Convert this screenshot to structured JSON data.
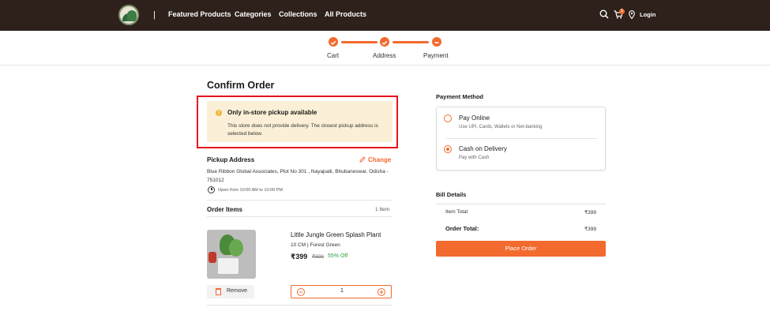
{
  "header": {
    "separator": "|",
    "nav": [
      "Featured Products",
      "Categories",
      "Collections",
      "All Products"
    ],
    "cart_count": "1",
    "login_label": "Login"
  },
  "stepper": {
    "steps": [
      "Cart",
      "Address",
      "Payment"
    ],
    "completed": 2,
    "current": 3
  },
  "page": {
    "title": "Confirm Order"
  },
  "alert": {
    "icon_glyph": "i",
    "title": "Only in-store pickup available",
    "body": "This store does not provide delivery. The closest pickup address is selected below."
  },
  "pickup": {
    "title": "Pickup Address",
    "change_label": "Change",
    "address": "Blue Ribbon Global Associates, Plot No 301 , Nayapalli, Bhubaneswar, Odisha - 751012",
    "hours": "Open from 10:00 AM to 10:00 PM"
  },
  "order_items": {
    "title": "Order Items",
    "count_label": "1 Item",
    "items": [
      {
        "name": "Little Jungle Green Splash Plant",
        "variant": "10 CM | Forest Green",
        "price": "₹399",
        "mrp": "₹899",
        "discount": "55% Off",
        "quantity": "1",
        "remove_label": "Remove",
        "minus_glyph": "−",
        "plus_glyph": "+"
      }
    ]
  },
  "payment": {
    "title": "Payment Method",
    "options": [
      {
        "name": "Pay Online",
        "sub": "Use UPI, Cards, Wallets or Net-banking",
        "selected": false
      },
      {
        "name": "Cash on Delivery",
        "sub": "Pay with Cash",
        "selected": true
      }
    ]
  },
  "bill": {
    "title": "Bill Details",
    "item_total_label": "Item Total",
    "item_total_value": "₹399",
    "order_total_label": "Order Total:",
    "order_total_value": "₹399",
    "place_order_label": "Place Order"
  },
  "icons": {
    "logo": "store-logo",
    "search": "search-icon",
    "cart": "cart-icon",
    "location": "location-pin-icon",
    "info": "info-icon",
    "edit": "pencil-icon",
    "clock": "clock-icon",
    "trash": "trash-icon"
  },
  "colors": {
    "header_bg": "#2e211b",
    "accent": "#f26a2e",
    "alert_bg": "#fbf0d7",
    "highlight_box": "#e8141c",
    "discount": "#2e9e3f"
  }
}
